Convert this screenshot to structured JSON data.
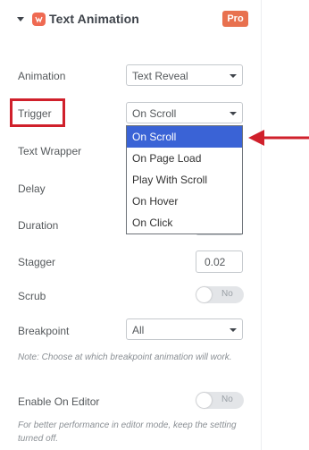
{
  "header": {
    "title": "Text Animation",
    "badge": "Pro"
  },
  "fields": {
    "animation": {
      "label": "Animation",
      "value": "Text Reveal"
    },
    "trigger": {
      "label": "Trigger",
      "value": "On Scroll"
    },
    "text_wrapper": {
      "label": "Text Wrapper"
    },
    "delay": {
      "label": "Delay"
    },
    "duration": {
      "label": "Duration"
    },
    "stagger": {
      "label": "Stagger",
      "value": "0.02"
    },
    "scrub": {
      "label": "Scrub",
      "toggle": "No"
    },
    "breakpoint": {
      "label": "Breakpoint",
      "value": "All"
    },
    "enable_on_editor": {
      "label": "Enable On Editor",
      "toggle": "No"
    }
  },
  "dropdown": {
    "options": [
      "On Scroll",
      "On Page Load",
      "Play With Scroll",
      "On Hover",
      "On Click"
    ],
    "selected": "On Scroll"
  },
  "notes": {
    "breakpoint": "Note: Choose at which breakpoint animation will work.",
    "editor": "For better performance in editor mode, keep the setting turned off."
  },
  "colors": {
    "accent": "#e8714f",
    "highlight": "#d0202b",
    "selected": "#3a63d6"
  },
  "icons": {
    "caret": "caret-down-icon",
    "logo": "plugin-logo-icon",
    "arrow": "red-arrow-icon"
  }
}
